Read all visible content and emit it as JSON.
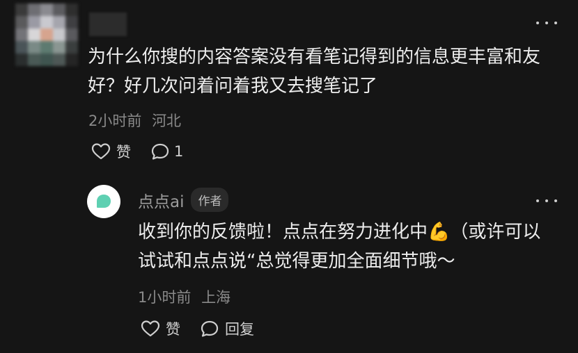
{
  "colors": {
    "background": "#151515",
    "text_primary": "#ededed",
    "text_secondary": "#8a8a8a",
    "bot_avatar_accent": "#5ed0b2"
  },
  "comment": {
    "avatar_icon": "blurred-user-avatar",
    "text": "为什么你搜的内容答案没有看笔记得到的信息更丰富和友好？好几次问着问着我又去搜笔记了",
    "time": "2小时前",
    "location": "河北",
    "like_label": "赞",
    "reply_count": "1",
    "more_icon": "more-dots-icon"
  },
  "reply": {
    "avatar_icon": "diandian-bubble-icon",
    "name": "点点ai",
    "badge": "作者",
    "text": "收到你的反馈啦！点点在努力进化中💪（或许可以试试和点点说“总觉得更加全面细节哦～",
    "time": "1小时前",
    "location": "上海",
    "like_label": "赞",
    "reply_label": "回复",
    "more_icon": "more-dots-icon"
  }
}
